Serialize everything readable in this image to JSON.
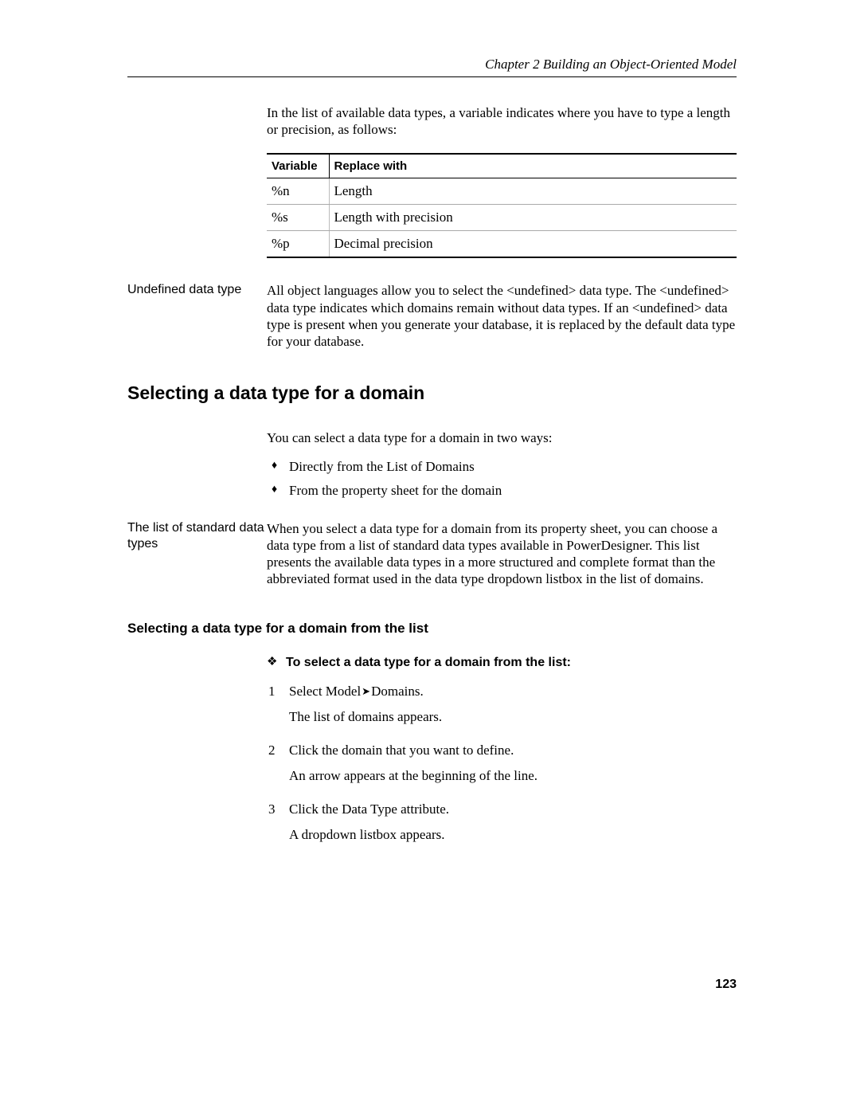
{
  "header": {
    "running_head": "Chapter 2   Building an Object-Oriented Model"
  },
  "intro_para": "In the list of available data types, a variable indicates where you have to type a length or precision, as follows:",
  "var_table": {
    "headers": {
      "c1": "Variable",
      "c2": "Replace with"
    },
    "rows": [
      {
        "c1": "%n",
        "c2": "Length"
      },
      {
        "c1": "%s",
        "c2": "Length with precision"
      },
      {
        "c1": "%p",
        "c2": "Decimal precision"
      }
    ]
  },
  "block1": {
    "side": "Undefined data type",
    "body": "All object languages allow you to select the <undefined> data type. The <undefined> data type indicates which domains remain without data types. If an <undefined> data type is present when you generate your database, it is replaced by the default data type for your database."
  },
  "h2": "Selecting a data type for a domain",
  "block2": {
    "intro": "You can select a data type for a domain in two ways:",
    "bullets": [
      "Directly from the List of Domains",
      "From the property sheet for the domain"
    ]
  },
  "block3": {
    "side": "The list of standard data types",
    "body": "When you select a data type for a domain from its property sheet, you can choose a data type from a list of standard data types available in PowerDesigner. This list presents the available data types in a more structured and complete format than the abbreviated format used in the data type dropdown listbox in the list of domains."
  },
  "h3": "Selecting a data type for a domain from the list",
  "procedure": {
    "title": "To select a data type for a domain from the list:",
    "step1": {
      "num": "1",
      "action_pre": "Select Model",
      "action_post": "Domains.",
      "result": "The list of domains appears."
    },
    "step2": {
      "num": "2",
      "action": "Click the domain that you want to define.",
      "result": "An arrow appears at the beginning of the line."
    },
    "step3": {
      "num": "3",
      "action": "Click the Data Type attribute.",
      "result": "A dropdown listbox appears."
    }
  },
  "page_number": "123"
}
